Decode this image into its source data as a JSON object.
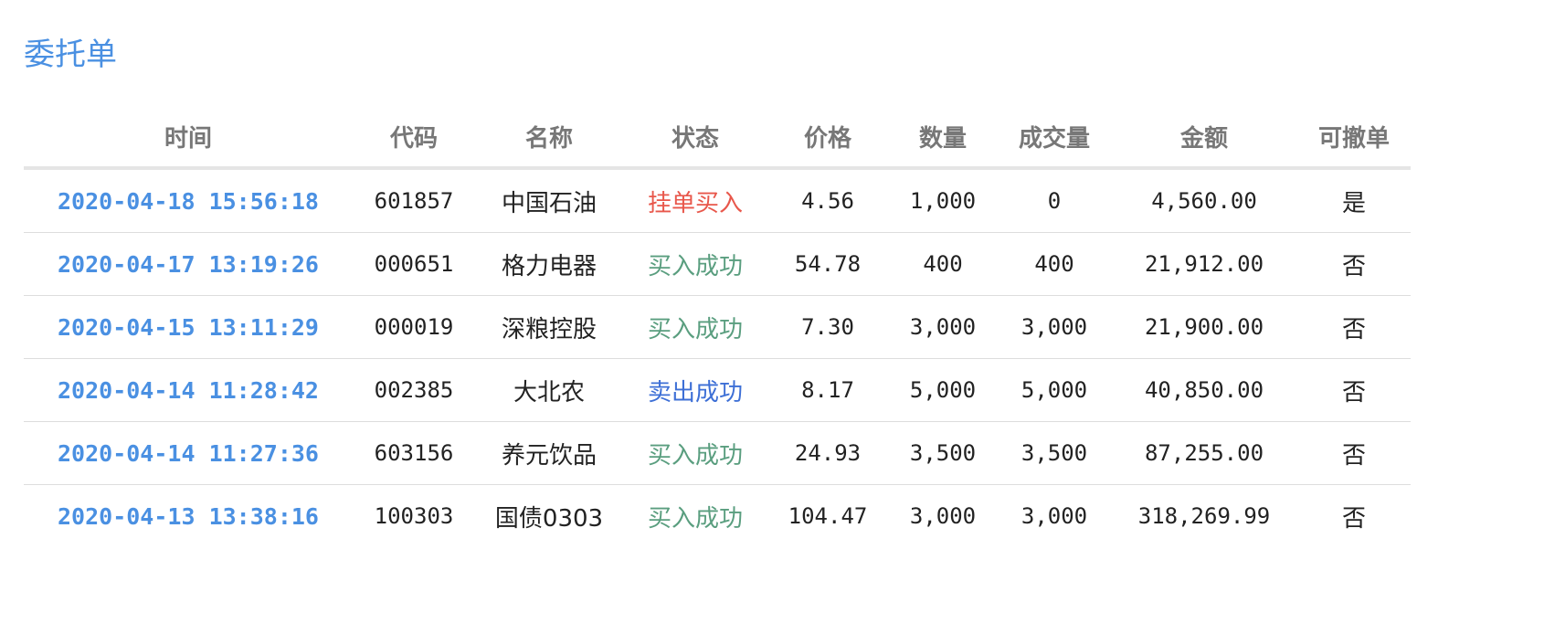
{
  "page": {
    "title": "委托单",
    "title_color": "#4a90e2"
  },
  "colors": {
    "pending_buy": "#e8574b",
    "buy_success": "#5a9e7f",
    "sell_success": "#3d6fd6"
  },
  "table": {
    "headers": [
      "时间",
      "代码",
      "名称",
      "状态",
      "价格",
      "数量",
      "成交量",
      "金额",
      "可撤单"
    ],
    "rows": [
      {
        "time": "2020-04-18 15:56:18",
        "code": "601857",
        "name": "中国石油",
        "status": "挂单买入",
        "status_type": "pending_buy",
        "price": "4.56",
        "quantity": "1,000",
        "filled": "0",
        "amount": "4,560.00",
        "cancelable": "是"
      },
      {
        "time": "2020-04-17 13:19:26",
        "code": "000651",
        "name": "格力电器",
        "status": "买入成功",
        "status_type": "buy_success",
        "price": "54.78",
        "quantity": "400",
        "filled": "400",
        "amount": "21,912.00",
        "cancelable": "否"
      },
      {
        "time": "2020-04-15 13:11:29",
        "code": "000019",
        "name": "深粮控股",
        "status": "买入成功",
        "status_type": "buy_success",
        "price": "7.30",
        "quantity": "3,000",
        "filled": "3,000",
        "amount": "21,900.00",
        "cancelable": "否"
      },
      {
        "time": "2020-04-14 11:28:42",
        "code": "002385",
        "name": "大北农",
        "status": "卖出成功",
        "status_type": "sell_success",
        "price": "8.17",
        "quantity": "5,000",
        "filled": "5,000",
        "amount": "40,850.00",
        "cancelable": "否"
      },
      {
        "time": "2020-04-14 11:27:36",
        "code": "603156",
        "name": "养元饮品",
        "status": "买入成功",
        "status_type": "buy_success",
        "price": "24.93",
        "quantity": "3,500",
        "filled": "3,500",
        "amount": "87,255.00",
        "cancelable": "否"
      },
      {
        "time": "2020-04-13 13:38:16",
        "code": "100303",
        "name": "国债0303",
        "status": "买入成功",
        "status_type": "buy_success",
        "price": "104.47",
        "quantity": "3,000",
        "filled": "3,000",
        "amount": "318,269.99",
        "cancelable": "否"
      }
    ]
  }
}
